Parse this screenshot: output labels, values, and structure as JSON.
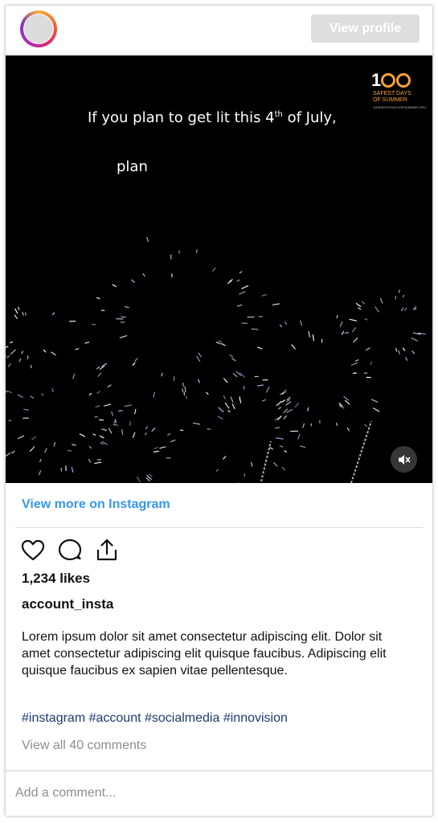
{
  "header": {
    "avatar_icon": "profile-avatar",
    "view_profile_label": "View profile"
  },
  "media": {
    "caption_line1_prefix": "If you plan to get lit this 4",
    "caption_line1_sup": "th",
    "caption_line1_suffix": " of July,",
    "caption_line2": "plan",
    "logo": {
      "number_left": "1",
      "number_mid": "0",
      "line1": "SAFEST DAYS",
      "line2": "OF SUMMER",
      "small": "100SAFESTDAYSOFSUMMER.ORG"
    },
    "mute_icon": "speaker-muted-icon",
    "background_color": "#000000",
    "accent_color": "#f7a23b"
  },
  "view_more_label": "View more on Instagram",
  "actions": {
    "like_icon": "heart-icon",
    "comment_icon": "comment-bubble-icon",
    "share_icon": "share-upload-icon"
  },
  "likes": "1,234 likes",
  "account": "account_insta",
  "description": "Lorem ipsum dolor sit amet consectetur adipiscing elit. Dolor sit amet consectetur adipiscing elit quisque faucibus. Adipiscing elit quisque faucibus ex sapien vitae pellentesque.",
  "hashtags": [
    "#instagram",
    "#account",
    "#socialmedia",
    "#innovision"
  ],
  "view_comments": "View all 40 comments",
  "comment_placeholder": "Add a comment...",
  "colors": {
    "link_blue": "#3897f0",
    "hashtag_navy": "#1e3a70",
    "muted_gray": "#8e8e8e"
  }
}
